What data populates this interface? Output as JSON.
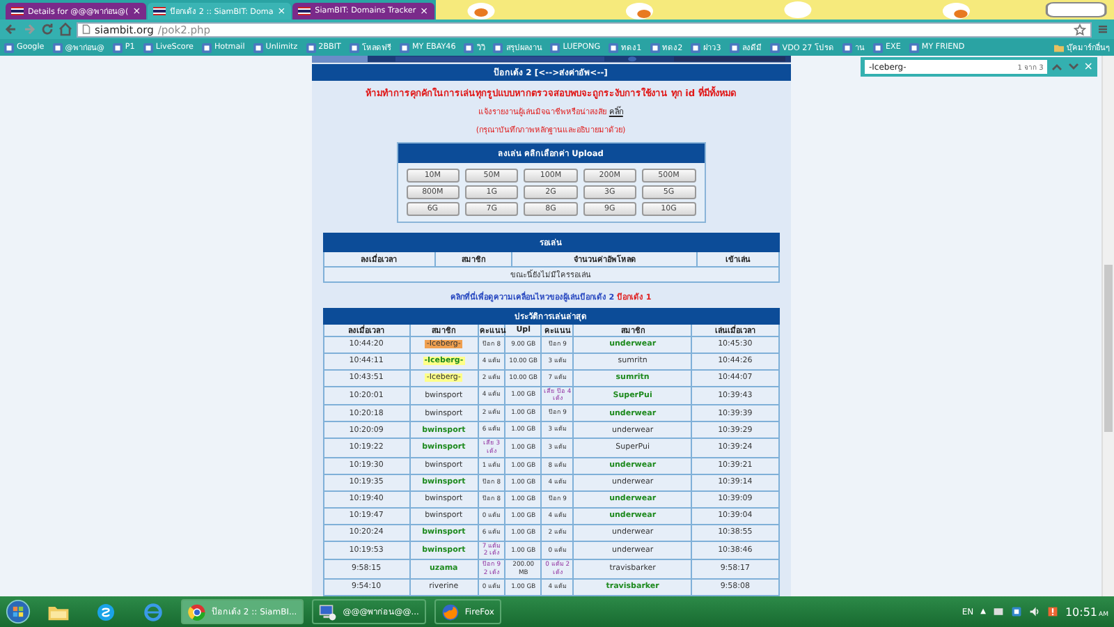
{
  "browser": {
    "tabs": [
      {
        "label": "Details for @@@พาก่อน@(",
        "selected": false
      },
      {
        "label": "ป๊อกเด้ง 2 :: SiamBIT: Doma",
        "selected": true
      },
      {
        "label": "SiamBIT: Domains Tracker",
        "selected": false
      }
    ],
    "tab_close": "×",
    "address": {
      "host": "siambit.org",
      "path": "/pok2.php"
    },
    "bookmarks": [
      "Google",
      "@พาก่อน@",
      "P1",
      "LiveScore",
      "Hotmail",
      "Unlimitz",
      "2BBIT",
      "โหลดฟรี",
      "MY EBAY46",
      "วิวิ",
      "สรุปผลงาน",
      "LUEPONG",
      "ทดง1",
      "ทดง2",
      "ฝาว3",
      "ลงดีมี",
      "VDO 27 โปรด",
      "าน",
      "EXE",
      "MY FRIEND"
    ],
    "other_bookmarks": "บุ๊คมาร์กอื่นๆ"
  },
  "find_bar": {
    "value": "-Iceberg-",
    "count": "1 จาก 3",
    "close": "×"
  },
  "page": {
    "header": "ป๊อกเด้ง 2 [<-->ส่งค่าอัพ<--]",
    "warning": "ห้ามทำการคุกคักในการเล่นทุกรูปแบบหากตรวจสอบพบจะถูกระงับการใช้งาน ทุก id ที่มีทั้งหมด",
    "report": {
      "text": "แจ้งรายงานผู้เล่นมิจฉาชีพหรือน่าสงสัย",
      "link": "คลิ๊ก"
    },
    "note": "(กรุณาบันทึกภาพหลักฐานและอธิบายมาด้วย)",
    "upload": {
      "title": "ลงเล่น คลิกเลือกค่า Upload",
      "options": [
        "10M",
        "50M",
        "100M",
        "200M",
        "500M",
        "800M",
        "1G",
        "2G",
        "3G",
        "5G",
        "6G",
        "7G",
        "8G",
        "9G",
        "10G"
      ]
    },
    "waiting": {
      "title": "รอเล่น",
      "columns": [
        "ลงเมื่อเวลา",
        "สมาชิก",
        "จำนวนค่าอัพโหลด",
        "เข้าเล่น"
      ],
      "empty": "ขณะนี้ยังไม่มีใครรอเล่น"
    },
    "activity_link": {
      "text": "คลิกที่นี่เพื่อดูความเคลื่อนไหวของผู้เล่นป๊อกเด้ง 2",
      "alt": "ป๊อกเด้ง 1"
    },
    "history": {
      "title": "ประวัติการเล่นล่าสุด",
      "columns": [
        "ลงเมื่อเวลา",
        "สมาชิก",
        "คะแนน",
        "Upl",
        "คะแนน",
        "สมาชิก",
        "เล่นเมื่อเวลา"
      ],
      "rows": [
        {
          "time": "10:44:20",
          "player": {
            "name": "-Iceberg-",
            "winner": false,
            "color": "#f0a050"
          },
          "score": {
            "text": "ป๊อก 8",
            "special": false
          },
          "upload": "9.00 GB",
          "opp_score": {
            "text": "ป๊อก 9",
            "special": false
          },
          "opponent": {
            "name": "underwear",
            "winner": true
          },
          "played": "10:45:30"
        },
        {
          "time": "10:44:11",
          "player": {
            "name": "-Iceberg-",
            "winner": true,
            "color": "#ffff88"
          },
          "score": {
            "text": "4 แต้ม",
            "special": false
          },
          "upload": "10.00 GB",
          "opp_score": {
            "text": "3 แต้ม",
            "special": false
          },
          "opponent": {
            "name": "sumritn",
            "winner": false
          },
          "played": "10:44:26"
        },
        {
          "time": "10:43:51",
          "player": {
            "name": "-Iceberg-",
            "winner": false,
            "color": "#ffff88"
          },
          "score": {
            "text": "2 แต้ม",
            "special": false
          },
          "upload": "10.00 GB",
          "opp_score": {
            "text": "7 แต้ม",
            "special": false
          },
          "opponent": {
            "name": "sumritn",
            "winner": true
          },
          "played": "10:44:07"
        },
        {
          "time": "10:20:01",
          "player": {
            "name": "bwinsport",
            "winner": false
          },
          "score": {
            "text": "4 แต้ม",
            "special": false
          },
          "upload": "1.00 GB",
          "opp_score": {
            "text": "เสีย ป๊อ 4 เด้ง",
            "special": true
          },
          "opponent": {
            "name": "SuperPui",
            "winner": true
          },
          "played": "10:39:43"
        },
        {
          "time": "10:20:18",
          "player": {
            "name": "bwinsport",
            "winner": false
          },
          "score": {
            "text": "2 แต้ม",
            "special": false
          },
          "upload": "1.00 GB",
          "opp_score": {
            "text": "ป๊อก 9",
            "special": false
          },
          "opponent": {
            "name": "underwear",
            "winner": true
          },
          "played": "10:39:39"
        },
        {
          "time": "10:20:09",
          "player": {
            "name": "bwinsport",
            "winner": true
          },
          "score": {
            "text": "6 แต้ม",
            "special": false
          },
          "upload": "1.00 GB",
          "opp_score": {
            "text": "3 แต้ม",
            "special": false
          },
          "opponent": {
            "name": "underwear",
            "winner": false
          },
          "played": "10:39:29"
        },
        {
          "time": "10:19:22",
          "player": {
            "name": "bwinsport",
            "winner": true
          },
          "score": {
            "text": "เสีย 3 เด้ง",
            "special": true
          },
          "upload": "1.00 GB",
          "opp_score": {
            "text": "3 แต้ม",
            "special": false
          },
          "opponent": {
            "name": "SuperPui",
            "winner": false
          },
          "played": "10:39:24"
        },
        {
          "time": "10:19:30",
          "player": {
            "name": "bwinsport",
            "winner": false
          },
          "score": {
            "text": "1 แต้ม",
            "special": false
          },
          "upload": "1.00 GB",
          "opp_score": {
            "text": "8 แต้ม",
            "special": false
          },
          "opponent": {
            "name": "underwear",
            "winner": true
          },
          "played": "10:39:21"
        },
        {
          "time": "10:19:35",
          "player": {
            "name": "bwinsport",
            "winner": true
          },
          "score": {
            "text": "ป๊อก 8",
            "special": false
          },
          "upload": "1.00 GB",
          "opp_score": {
            "text": "4 แต้ม",
            "special": false
          },
          "opponent": {
            "name": "underwear",
            "winner": false
          },
          "played": "10:39:14"
        },
        {
          "time": "10:19:40",
          "player": {
            "name": "bwinsport",
            "winner": false
          },
          "score": {
            "text": "ป๊อก 8",
            "special": false
          },
          "upload": "1.00 GB",
          "opp_score": {
            "text": "ป๊อก 9",
            "special": false
          },
          "opponent": {
            "name": "underwear",
            "winner": true
          },
          "played": "10:39:09"
        },
        {
          "time": "10:19:47",
          "player": {
            "name": "bwinsport",
            "winner": false
          },
          "score": {
            "text": "0 แต้ม",
            "special": false
          },
          "upload": "1.00 GB",
          "opp_score": {
            "text": "4 แต้ม",
            "special": false
          },
          "opponent": {
            "name": "underwear",
            "winner": true
          },
          "played": "10:39:04"
        },
        {
          "time": "10:20:24",
          "player": {
            "name": "bwinsport",
            "winner": true
          },
          "score": {
            "text": "6 แต้ม",
            "special": false
          },
          "upload": "1.00 GB",
          "opp_score": {
            "text": "2 แต้ม",
            "special": false
          },
          "opponent": {
            "name": "underwear",
            "winner": false
          },
          "played": "10:38:55"
        },
        {
          "time": "10:19:53",
          "player": {
            "name": "bwinsport",
            "winner": true
          },
          "score": {
            "text": "7 แต้ม 2 เด้ง",
            "special": true
          },
          "upload": "1.00 GB",
          "opp_score": {
            "text": "0 แต้ม",
            "special": false
          },
          "opponent": {
            "name": "underwear",
            "winner": false
          },
          "played": "10:38:46"
        },
        {
          "time": "9:58:15",
          "player": {
            "name": "uzama",
            "winner": true
          },
          "score": {
            "text": "ป๊อก 9 2 เด้ง",
            "special": true
          },
          "upload": "200.00 MB",
          "opp_score": {
            "text": "0 แต้ม 2 เด้ง",
            "special": true
          },
          "opponent": {
            "name": "travisbarker",
            "winner": false
          },
          "played": "9:58:17"
        },
        {
          "time": "9:54:10",
          "player": {
            "name": "riverine",
            "winner": false
          },
          "score": {
            "text": "0 แต้ม",
            "special": false
          },
          "upload": "1.00 GB",
          "opp_score": {
            "text": "4 แต้ม",
            "special": false
          },
          "opponent": {
            "name": "travisbarker",
            "winner": true
          },
          "played": "9:58:08"
        }
      ]
    }
  },
  "taskbar": {
    "windows": [
      {
        "label": "ป๊อกเด้ง 2 :: SiamBI...",
        "kind": "chrome",
        "selected": true
      },
      {
        "label": "@@@พาก่อน@@...",
        "kind": "computer",
        "selected": false
      },
      {
        "label": "FireFox",
        "kind": "firefox",
        "selected": false
      }
    ],
    "language": "EN",
    "tray_arrow": "▲",
    "time": "10:51",
    "ampm": "AM"
  }
}
